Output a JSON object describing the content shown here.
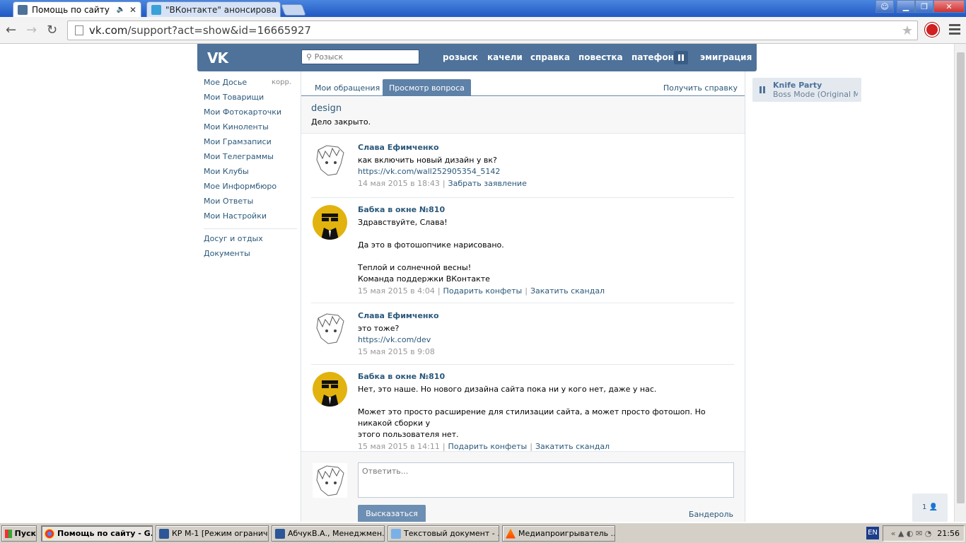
{
  "browser": {
    "tabs": [
      {
        "title": "Помощь по сайту",
        "active": true
      },
      {
        "title": "\"ВКонтакте\" анонсировала",
        "active": false
      }
    ],
    "url_host": "vk.com",
    "url_path": "/support?act=show&id=16665927"
  },
  "vk_header": {
    "logo": "VK",
    "search_placeholder": "Розыск",
    "nav": [
      "розыск",
      "качели",
      "справка",
      "повестка",
      "патефон",
      "эмиграция"
    ]
  },
  "left_menu": {
    "items": [
      "Мое Досье",
      "Мои Товарищи",
      "Мои Фотокарточки",
      "Мои Киноленты",
      "Мои Грамзаписи",
      "Мои Телеграммы",
      "Мои Клубы",
      "Мое Информбюро",
      "Мои Ответы",
      "Мои Настройки"
    ],
    "korr": "корр.",
    "extra": [
      "Досуг и отдых",
      "Документы"
    ]
  },
  "support": {
    "tabs": [
      "Мои обращения",
      "Просмотр вопроса"
    ],
    "help_link": "Получить справку",
    "topic_title": "design",
    "topic_status": "Дело закрыто."
  },
  "posts": [
    {
      "author": "Слава Ефимченко",
      "lines": [
        "как включить новый дизайн у вк?"
      ],
      "link": "https://vk.com/wall252905354_5142",
      "date": "14 мая 2015 в 18:43",
      "actions": [
        "Забрать заявление"
      ]
    },
    {
      "author": "Бабка в окне №810",
      "lines": [
        "Здравствуйте, Слава!",
        "",
        "Да это в фотошопчике нарисовано.",
        "",
        "Теплой и солнечной весны!",
        "Команда поддержки ВКонтакте"
      ],
      "link": "",
      "date": "15 мая 2015 в 4:04",
      "actions": [
        "Подарить конфеты",
        "Закатить скандал"
      ]
    },
    {
      "author": "Слава Ефимченко",
      "lines": [
        "это тоже?"
      ],
      "link": "https://vk.com/dev",
      "date": "15 мая 2015 в 9:08",
      "actions": []
    },
    {
      "author": "Бабка в окне №810",
      "lines": [
        "Нет, это наше. Но нового дизайна сайта пока ни у кого нет, даже у нас.",
        "",
        "Может это просто расширение для стилизации сайта, а может просто фотошоп. Но никакой сборки у",
        "этого пользователя нет."
      ],
      "link": "",
      "date": "15 мая 2015 в 14:11",
      "actions": [
        "Подарить конфеты",
        "Закатить скандал"
      ]
    }
  ],
  "reply": {
    "placeholder": "Ответить...",
    "send_label": "Высказаться",
    "parcel_link": "Бандероль"
  },
  "player": {
    "artist": "Knife Party",
    "track": "Boss Mode (Original M..."
  },
  "friends_count": "1",
  "taskbar": {
    "start": "Пуск",
    "tasks": [
      "Помощь по сайту - G...",
      "КР М-1 [Режим огранич...",
      "АбчукВ.А., Менеджмен...",
      "Текстовый документ - ...",
      "Медиапроигрыватель ..."
    ],
    "lang": "EN",
    "clock": "21:56"
  },
  "colors": {
    "vk_blue": "#4e729a",
    "link": "#2b587a"
  }
}
